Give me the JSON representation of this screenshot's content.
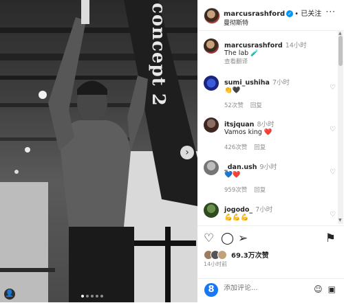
{
  "post": {
    "username": "marcusrashford",
    "follow_label": "• 已关注",
    "location": "曼彻斯特",
    "more_label": "···",
    "brand_text": "concept 2"
  },
  "caption": {
    "username": "marcusrashford",
    "time": "14小时",
    "text": "The lab 🧪",
    "translate": "查看翻译"
  },
  "comments": [
    {
      "username": "sumi_ushiha",
      "time": "7小时",
      "text": "👏🖤",
      "likes": "52次赞",
      "reply": "回复"
    },
    {
      "username": "itsjquan",
      "time": "8小时",
      "text": "Vamos king ❤️",
      "likes": "426次赞",
      "reply": "回复"
    },
    {
      "username": "_dan.ush",
      "time": "9小时",
      "text": "💙❤️",
      "likes": "959次赞",
      "reply": "回复"
    },
    {
      "username": "jogodo_",
      "time": "7小时",
      "text": "💪💪💪",
      "likes": "",
      "reply": ""
    }
  ],
  "stats": {
    "likes": "69.3万次赞",
    "posted": "14小时前"
  },
  "comment_box": {
    "placeholder": "添加评论..."
  },
  "colors": {
    "verified": "#0095f6",
    "heart": "#ed4956",
    "muted": "#8e8e8e"
  },
  "icons": {
    "like": "heart-icon",
    "comment": "comment-icon",
    "share": "share-icon",
    "save": "bookmark-icon",
    "next": "chevron-right-icon",
    "tag": "user-tag-icon"
  }
}
